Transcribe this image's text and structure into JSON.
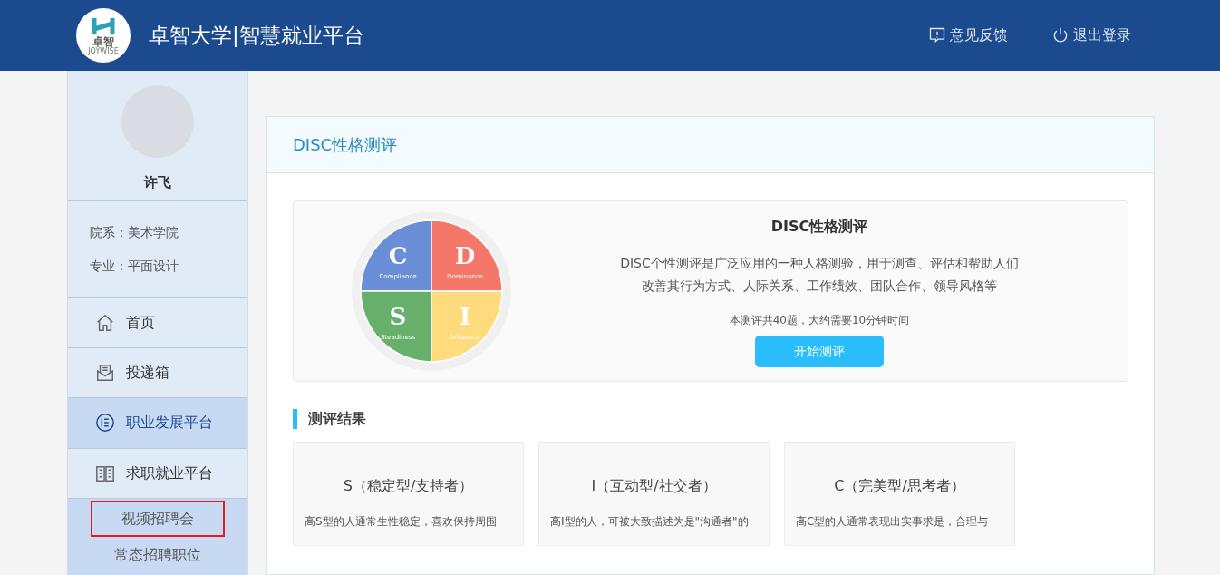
{
  "header": {
    "logo_text": "卓智",
    "logo_subtext": "JOYWISE",
    "title": "卓智大学|智慧就业平台",
    "actions": [
      {
        "kind": "feedback",
        "label": "意见反馈"
      },
      {
        "kind": "logout",
        "label": "退出登录"
      }
    ]
  },
  "sidebar": {
    "user": {
      "name": "许飞"
    },
    "info": [
      "院系：美术学院",
      "专业：平面设计"
    ],
    "items": [
      {
        "kind": "home",
        "label": "首页",
        "selected": false
      },
      {
        "kind": "mailbox",
        "label": "投递箱",
        "selected": false
      },
      {
        "kind": "list",
        "label": "职业发展平台",
        "selected": true
      },
      {
        "kind": "book",
        "label": "求职就业平台",
        "selected": false,
        "children": [
          {
            "label": "视频招聘会",
            "selected": true
          },
          {
            "label": "常态招聘职位",
            "selected": false
          }
        ]
      }
    ]
  },
  "panel": {
    "title": "DISC性格测评",
    "intro": {
      "quadrants": [
        {
          "letter": "C",
          "name": "Compliance",
          "color": "#6a8fd8"
        },
        {
          "letter": "D",
          "name": "Dominance",
          "color": "#f4776a"
        },
        {
          "letter": "S",
          "name": "Steadiness",
          "color": "#66b06b"
        },
        {
          "letter": "I",
          "name": "Influence",
          "color": "#fedc7e"
        }
      ],
      "heading": "DISC性格测评",
      "description": [
        "DISC个性测评是广泛应用的一种人格测验，用于测查、评估和帮助人们",
        "改善其行为方式、人际关系、工作绩效、团队合作、领导风格等"
      ],
      "note": "本测评共40题，大约需要10分钟时间",
      "button": "开始测评"
    },
    "results_title": "测评结果",
    "results": [
      {
        "title": "S（稳定型/支持者）",
        "text": "高S型的人通常生性稳定，喜欢保持周围"
      },
      {
        "title": "I（互动型/社交者）",
        "text": "高I型的人，可被大致描述为是\"沟通者\"的"
      },
      {
        "title": "C（完美型/思考者）",
        "text": "高C型的人通常表现出实事求是，合理与"
      }
    ]
  }
}
